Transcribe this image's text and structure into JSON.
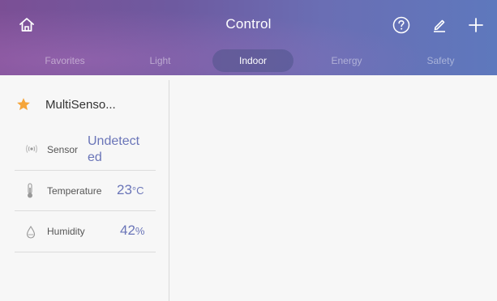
{
  "header": {
    "title": "Control",
    "icons": {
      "home": "home-icon",
      "help": "help-circle-icon",
      "edit": "pencil-icon",
      "add": "plus-icon"
    }
  },
  "tabs": [
    {
      "label": "Favorites",
      "active": false
    },
    {
      "label": "Light",
      "active": false
    },
    {
      "label": "Indoor",
      "active": true
    },
    {
      "label": "Energy",
      "active": false
    },
    {
      "label": "Safety",
      "active": false
    }
  ],
  "device": {
    "name": "MultiSenso...",
    "favorite": true,
    "rows": [
      {
        "label": "Sensor",
        "value_line1": "Undetect",
        "value_line2": "ed",
        "icon": "signal-icon"
      },
      {
        "label": "Temperature",
        "value": "23",
        "unit": "°C",
        "icon": "thermometer-icon"
      },
      {
        "label": "Humidity",
        "value": "42",
        "unit": "%",
        "icon": "water-drop-icon"
      }
    ]
  },
  "colors": {
    "accent": "#6a75b8",
    "star": "#f5a53a",
    "header_start": "#7b4f95",
    "header_end": "#5e78bd"
  }
}
